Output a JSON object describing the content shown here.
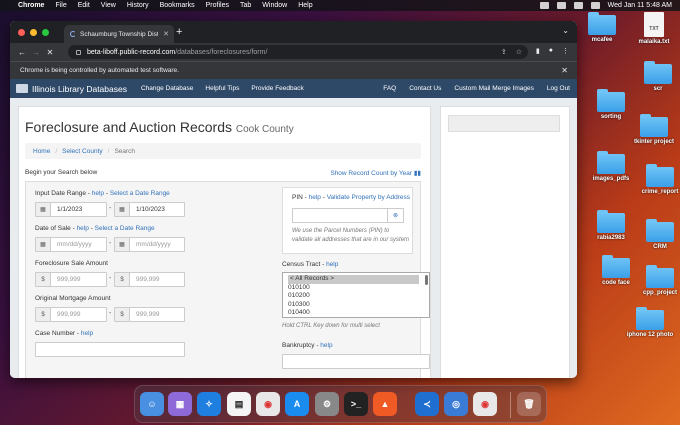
{
  "menubar": {
    "apple": "",
    "app": "Chrome",
    "items": [
      "File",
      "Edit",
      "View",
      "History",
      "Bookmarks",
      "Profiles",
      "Tab",
      "Window",
      "Help"
    ],
    "clock": "Wed Jan 11  5:48 AM"
  },
  "desktop": [
    {
      "label": "mcafee",
      "kind": "folder"
    },
    {
      "label": "malaika.txt",
      "kind": "file",
      "ext": "TXT"
    },
    {
      "label": "scr",
      "kind": "folder"
    },
    {
      "label": "sorting",
      "kind": "folder"
    },
    {
      "label": "tkinter project",
      "kind": "folder"
    },
    {
      "label": "images_pdfs",
      "kind": "folder"
    },
    {
      "label": "crime_report",
      "kind": "folder"
    },
    {
      "label": "rabia2983",
      "kind": "folder"
    },
    {
      "label": "CRM",
      "kind": "folder"
    },
    {
      "label": "code face",
      "kind": "folder"
    },
    {
      "label": "cpp_project",
      "kind": "folder"
    },
    {
      "label": "iphone 12 photo",
      "kind": "folder"
    }
  ],
  "browser": {
    "tab_title": "Schaumburg Township District",
    "url_host": "beta-liboff.public-record.com",
    "url_path": "/databases/foreclosures/form/",
    "infobar": "Chrome is being controlled by automated test software."
  },
  "site": {
    "brand": "Illinois Library Databases",
    "nav_left": [
      "Change Database",
      "Helpful Tips",
      "Provide Feedback"
    ],
    "nav_right": [
      "FAQ",
      "Contact Us",
      "Custom Mail Merge Images",
      "Log Out"
    ]
  },
  "page": {
    "title": "Foreclosure and Auction Records",
    "county": "Cook County",
    "breadcrumb": {
      "home": "Home",
      "select_county": "Select County",
      "current": "Search"
    },
    "subhead": "Begin your Search below",
    "record_count_link": "Show Record Count by Year",
    "input_date_range": {
      "label": "Input Date Range - ",
      "help": "help",
      "sep": " - ",
      "select": "Select a Date Range",
      "from": "1/1/2023",
      "to": "1/10/2023"
    },
    "date_of_sale": {
      "label": "Date of Sale - ",
      "help": "help",
      "sep": " - ",
      "select": "Select a Date Range",
      "placeholder": "mm/dd/yyyy"
    },
    "sale_amount": {
      "label": "Foreclosure Sale Amount",
      "placeholder": "999,999"
    },
    "mortgage_amount": {
      "label": "Original Mortgage Amount",
      "placeholder": "999,999"
    },
    "case_number": {
      "label": "Case Number - ",
      "help": "help"
    },
    "pin": {
      "label": "PIN - ",
      "help": "help",
      "sep": " - ",
      "validate": "Validate Property by Address",
      "help_text": "We use the Parcel Numbers (PIN) to validate all addresses that are in our system"
    },
    "census": {
      "label": "Census Tract - ",
      "help": "help",
      "options": [
        "< All Records >",
        "010100",
        "010200",
        "010300",
        "010400"
      ],
      "hold_help": "Hold CTRL Key down for multi select"
    },
    "bankruptcy": {
      "label": "Bankruptcy - ",
      "help": "help"
    }
  }
}
